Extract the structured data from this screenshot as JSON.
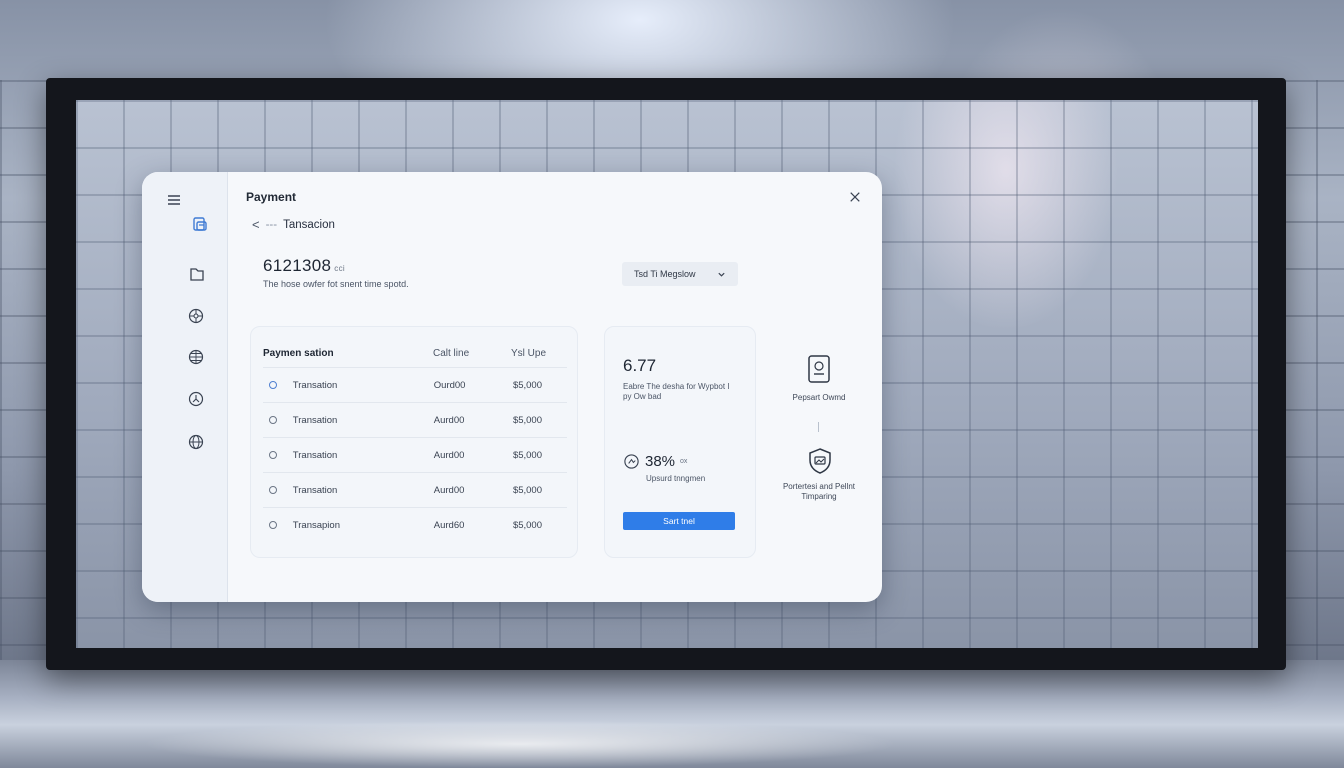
{
  "window": {
    "title": "Payment",
    "close_icon": "close-icon"
  },
  "sidebar": {
    "items": [
      {
        "icon": "menu-icon"
      },
      {
        "icon": "wallet-icon"
      },
      {
        "icon": "folder-icon"
      },
      {
        "icon": "network-icon"
      },
      {
        "icon": "globe-grid-icon"
      },
      {
        "icon": "clock-icon"
      },
      {
        "icon": "globe-icon"
      }
    ],
    "accent": "#3f7bd4"
  },
  "breadcrumb": {
    "back_icon": "<",
    "separator": "---",
    "label": "Tansacion"
  },
  "summary": {
    "amount": "6121308",
    "unit": "cci",
    "description": "The hose owfer fot snent time spotd."
  },
  "dropdown": {
    "selected": "Tsd Ti Megslow",
    "chevron_icon": "chevron-down-icon"
  },
  "table": {
    "headers": [
      "Paymen sation",
      "Calt line",
      "Ysl Upe"
    ],
    "rows": [
      {
        "name": "Transation",
        "code": "Ourd00",
        "amount": "$5,000"
      },
      {
        "name": "Transation",
        "code": "Aurd00",
        "amount": "$5,000"
      },
      {
        "name": "Transation",
        "code": "Aurd00",
        "amount": "$5,000"
      },
      {
        "name": "Transation",
        "code": "Aurd00",
        "amount": "$5,000"
      },
      {
        "name": "Transapion",
        "code": "Aurd60",
        "amount": "$5,000"
      }
    ]
  },
  "stats": {
    "value": "6.77",
    "description": "Eabre The desha for Wypbot I py Ow bad",
    "percent": "38%",
    "percent_unit": "ox",
    "percent_desc": "Upsurd tnngmen",
    "button_label": "Sart tnel",
    "button_color": "#2f7de8"
  },
  "info": {
    "item1_label": "Pepsart Owmd",
    "item1_icon": "document-icon",
    "item2_label": "Portertesi and Pellnt Timparing",
    "item2_icon": "shield-icon"
  }
}
